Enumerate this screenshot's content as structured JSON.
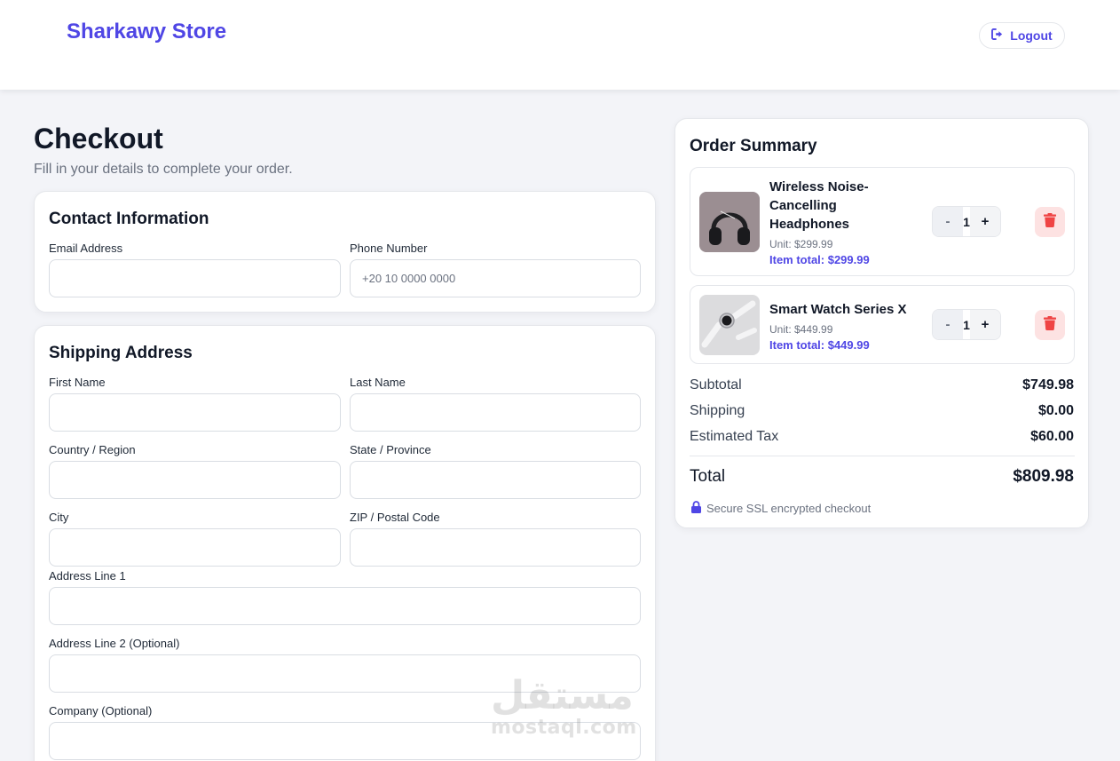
{
  "header": {
    "brand": "Sharkawy Store",
    "logout_label": "Logout"
  },
  "page": {
    "title": "Checkout",
    "subtitle": "Fill in your details to complete your order."
  },
  "contact": {
    "title": "Contact Information",
    "email_label": "Email Address",
    "email_value": "",
    "phone_label": "Phone Number",
    "phone_placeholder": "+20 10 0000 0000"
  },
  "shipping": {
    "title": "Shipping Address",
    "first_name_label": "First Name",
    "last_name_label": "Last Name",
    "country_label": "Country / Region",
    "state_label": "State / Province",
    "city_label": "City",
    "zip_label": "ZIP / Postal Code",
    "address1_label": "Address Line 1",
    "address2_label": "Address Line 2 (Optional)",
    "company_label": "Company (Optional)"
  },
  "summary": {
    "title": "Order Summary",
    "items": [
      {
        "name": "Wireless Noise-Cancelling Headphones",
        "unit": "Unit: $299.99",
        "total": "Item total: $299.99",
        "quantity": "1",
        "minus": "-",
        "plus": "+"
      },
      {
        "name": "Smart Watch Series X",
        "unit": "Unit: $449.99",
        "total": "Item total: $449.99",
        "quantity": "1",
        "minus": "-",
        "plus": "+"
      }
    ],
    "subtotal_label": "Subtotal",
    "subtotal_value": "$749.98",
    "shipping_label": "Shipping",
    "shipping_value": "$0.00",
    "tax_label": "Estimated Tax",
    "tax_value": "$60.00",
    "total_label": "Total",
    "total_value": "$809.98",
    "secure_text": "Secure SSL encrypted checkout"
  },
  "watermark": {
    "arabic": "مستقل",
    "latin": "mostaql.com"
  },
  "colors": {
    "accent": "#4f46e5",
    "danger": "#ef4444",
    "danger_bg": "#fde2e2",
    "page_bg": "#f3f4f8"
  },
  "icons": {
    "logout": "logout-icon",
    "trash": "trash-icon",
    "lock": "lock-icon"
  }
}
